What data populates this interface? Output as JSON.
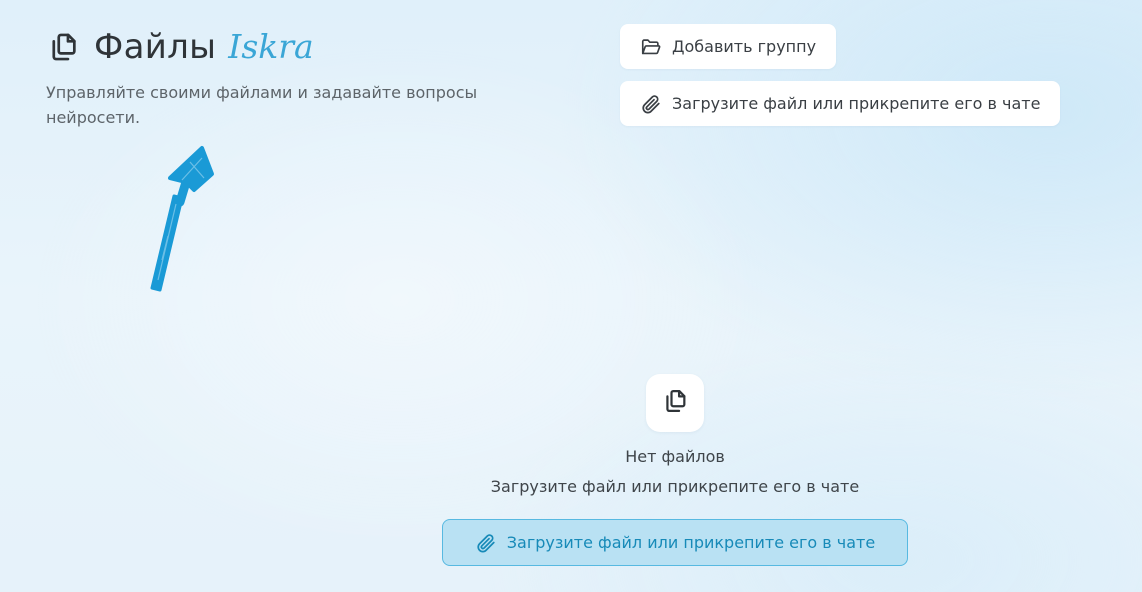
{
  "header": {
    "icon": "files-icon",
    "title": "Файлы",
    "brand": "Iskra",
    "subtitle": "Управляйте своими файлами и задавайте вопросы нейросети."
  },
  "actions": {
    "add_group_label": "Добавить группу",
    "add_group_icon": "folder-open-icon",
    "upload_label": "Загрузите файл или прикрепите его в чате",
    "upload_icon": "paperclip-icon"
  },
  "empty_state": {
    "icon": "files-icon",
    "title": "Нет файлов",
    "subtitle": "Загрузите файл или прикрепите его в чате",
    "cta_label": "Загрузите файл или прикрепите его в чате",
    "cta_icon": "paperclip-icon"
  },
  "annotation": {
    "arrow_icon": "hand-drawn-arrow-icon",
    "color": "#1a9ad6"
  },
  "colors": {
    "brand": "#3aa6d6",
    "cta_background": "#b9e1f3",
    "cta_border": "#57b9e1",
    "cta_text": "#178ab8"
  }
}
